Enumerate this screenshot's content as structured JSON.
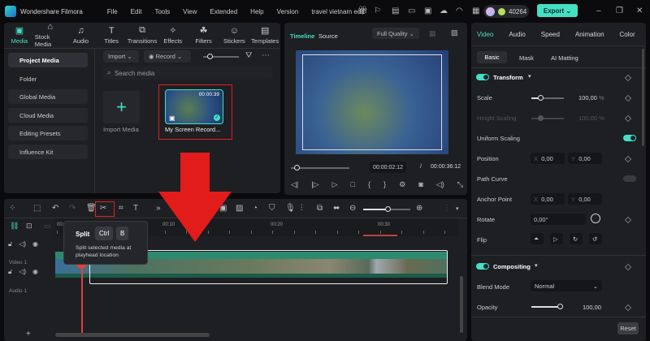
{
  "app": {
    "name": "Wondershare Filmora",
    "project": "travel vietnam edit",
    "credits": "40264",
    "export": "Export"
  },
  "menu": [
    "File",
    "Edit",
    "Tools",
    "View",
    "Extended",
    "Help",
    "Version"
  ],
  "toolbar_tabs": [
    {
      "label": "Media",
      "icon": "▣"
    },
    {
      "label": "Stock Media",
      "icon": "⌂"
    },
    {
      "label": "Audio",
      "icon": "♫"
    },
    {
      "label": "Titles",
      "icon": "T"
    },
    {
      "label": "Transitions",
      "icon": "⧉"
    },
    {
      "label": "Effects",
      "icon": "✧"
    },
    {
      "label": "Filters",
      "icon": "☘"
    },
    {
      "label": "Stickers",
      "icon": "☺"
    },
    {
      "label": "Templates",
      "icon": "▤"
    }
  ],
  "sidebar": [
    "Project Media",
    "Folder",
    "Global Media",
    "Cloud Media",
    "Editing Presets",
    "Influence Kit"
  ],
  "media": {
    "import": "Import",
    "record": "Record",
    "search_placeholder": "Search media",
    "import_media": "Import Media",
    "clip_name": "My Screen Record...",
    "clip_duration": "00:00:39"
  },
  "preview": {
    "tab_timeline": "Timeline",
    "tab_source": "Source",
    "quality": "Full Quality",
    "current": "00:00:02:12",
    "sep": "/",
    "total": "00:00:36:12"
  },
  "right": {
    "tabs": [
      "Video",
      "Audio",
      "Speed",
      "Animation",
      "Color"
    ],
    "subtabs": [
      "Basic",
      "Mask",
      "AI Matting"
    ],
    "transform": "Transform",
    "scale": "Scale",
    "scale_val": "100,00",
    "pct": "%",
    "height_scaling": "Height Scaling",
    "height_val": "100,00",
    "uniform": "Uniform Scaling",
    "position": "Position",
    "x": "X",
    "y": "Y",
    "pos_x": "0,00",
    "pos_y": "0,00",
    "path_curve": "Path Curve",
    "anchor": "Anchor Point",
    "anc_x": "0,00",
    "anc_y": "0,00",
    "rotate": "Rotate",
    "rotate_val": "0,00°",
    "flip": "Flip",
    "compositing": "Compositing",
    "blend": "Blend Mode",
    "blend_val": "Normal",
    "opacity": "Opacity",
    "opacity_val": "100,00",
    "reset": "Reset",
    "scale_fraction": 0.25,
    "opacity_fraction": 1.0
  },
  "tooltip": {
    "title": "Split",
    "key1": "Ctrl",
    "key2": "B",
    "desc": "Split selected media at playhead location"
  },
  "timeline": {
    "ruler": [
      "00:0",
      "00:10",
      "00:20",
      "00:30"
    ],
    "video_track": "Video 1",
    "audio_track": "Audio 1"
  }
}
